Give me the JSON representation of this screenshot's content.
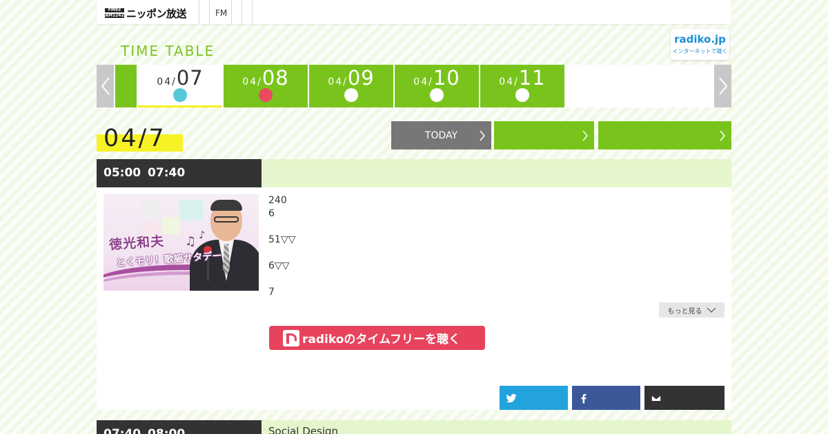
{
  "header": {
    "logo_top": "FM93",
    "logo_bottom": "AM1242",
    "logo_text": "ニッポン放送",
    "nav_fm": "FM"
  },
  "timetable_title": "TIME TABLE",
  "radiko_badge": {
    "main": "radiko.jp",
    "sub": "インターネットで聴く"
  },
  "dates": [
    {
      "month": "04/",
      "day": "07",
      "dot_color": "#54cad8",
      "active": true
    },
    {
      "month": "04/",
      "day": "08",
      "dot_color": "#ea4a5f",
      "active": false
    },
    {
      "month": "04/",
      "day": "09",
      "dot_color": "#ffffff",
      "active": false
    },
    {
      "month": "04/",
      "day": "10",
      "dot_color": "#ffffff",
      "active": false
    },
    {
      "month": "04/",
      "day": "11",
      "dot_color": "#ffffff",
      "active": false
    }
  ],
  "current_day": "04/7",
  "buttons": {
    "today": "TODAY"
  },
  "programs": [
    {
      "time": "05:00  07:40",
      "title": "",
      "image_title_line1": "徳光和夫",
      "image_title_line2": "とくモリ！歌謡サタデー",
      "description": [
        "240",
        "6",
        "",
        "51▽▽",
        "",
        "6▽▽",
        "",
        "7"
      ],
      "more_label": "もっと見る",
      "radiko_label": "radikoのタイムフリーを聴く"
    },
    {
      "time": "07:40  08:00",
      "title": "Social Design"
    }
  ],
  "colors": {
    "green": "#79c41c",
    "dark": "#333333",
    "light_green": "#e5f6cc",
    "highlight": "#f7f225",
    "radiko_red": "#e7435c",
    "twitter": "#22a3dd",
    "facebook": "#3b5999"
  }
}
